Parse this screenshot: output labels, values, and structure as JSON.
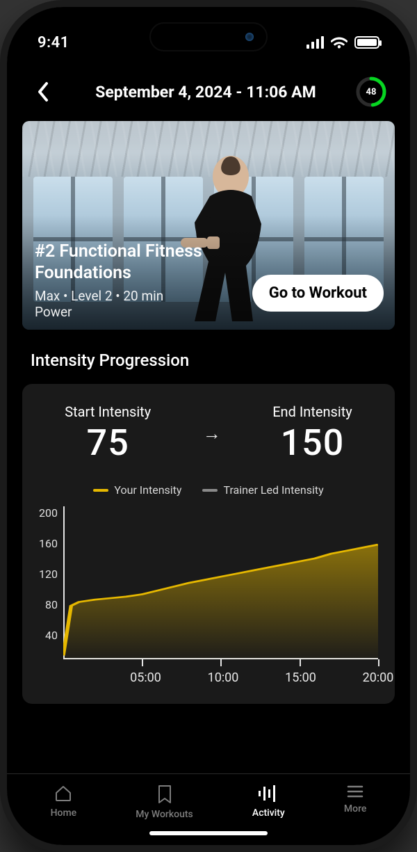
{
  "status": {
    "time": "9:41"
  },
  "header": {
    "title": "September 4, 2024 - 11:06 AM",
    "ring_value": "48",
    "ring_max": 100
  },
  "hero": {
    "title": "#2 Functional Fitness Foundations",
    "meta": "Max • Level 2 • 20 min\nPower",
    "cta_label": "Go to Workout"
  },
  "section_title": "Intensity Progression",
  "intensity": {
    "start_label": "Start Intensity",
    "start_value": "75",
    "end_label": "End Intensity",
    "end_value": "150"
  },
  "legend": {
    "your_label": "Your Intensity",
    "trainer_label": "Trainer Led Intensity"
  },
  "chart_data": {
    "type": "area",
    "xlabel": "",
    "ylabel": "",
    "ylim": [
      0,
      200
    ],
    "xlim": [
      0,
      20
    ],
    "y_ticks": [
      200,
      160,
      120,
      80,
      40
    ],
    "x_ticks": [
      "05:00",
      "10:00",
      "15:00",
      "20:00"
    ],
    "series": [
      {
        "name": "Your Intensity",
        "color": "#e6b800",
        "x": [
          0.0,
          0.5,
          1.0,
          2.0,
          3.0,
          4.0,
          5.0,
          6.0,
          7.0,
          8.0,
          9.0,
          10.0,
          11.0,
          12.0,
          13.0,
          14.0,
          15.0,
          16.0,
          17.0,
          18.0,
          19.0,
          20.0
        ],
        "values": [
          5,
          70,
          75,
          78,
          80,
          82,
          85,
          90,
          95,
          100,
          104,
          108,
          112,
          116,
          120,
          124,
          128,
          132,
          138,
          142,
          146,
          150
        ]
      },
      {
        "name": "Trainer Led Intensity",
        "color": "#8a8a8a",
        "x": [],
        "values": []
      }
    ]
  },
  "tabs": {
    "home": "Home",
    "workouts": "My Workouts",
    "activity": "Activity",
    "more": "More"
  }
}
